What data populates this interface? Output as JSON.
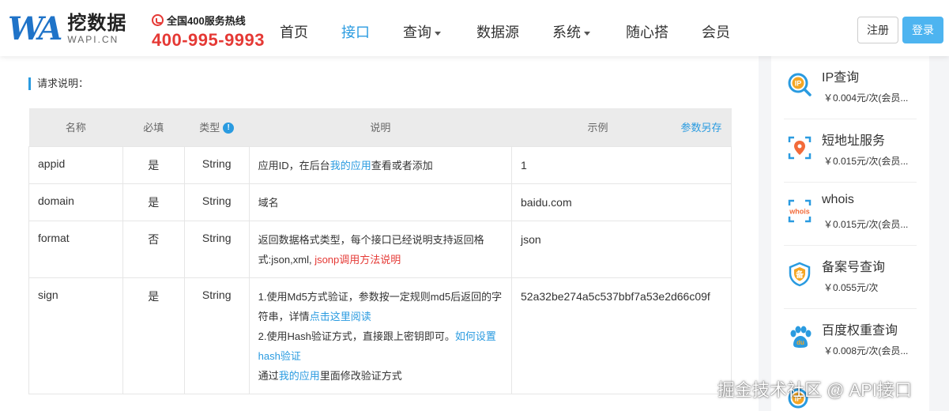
{
  "header": {
    "logo_mark": "WA",
    "logo_cn": "挖数据",
    "logo_en": "WAPI.CN",
    "hotline_label": "全国400服务热线",
    "hotline_number": "400-995-9993",
    "nav": [
      {
        "label": "首页"
      },
      {
        "label": "接口"
      },
      {
        "label": "查询"
      },
      {
        "label": "数据源"
      },
      {
        "label": "系统"
      },
      {
        "label": "随心搭"
      },
      {
        "label": "会员"
      }
    ],
    "register_label": "注册",
    "login_label": "登录"
  },
  "main": {
    "section_title": "请求说明：",
    "columns": {
      "name": "名称",
      "required": "必填",
      "type": "类型",
      "type_info": "!",
      "description": "说明",
      "example": "示例",
      "save_link": "参数另存"
    },
    "rows": [
      {
        "name": "appid",
        "required": "是",
        "type": "String",
        "desc_pre": "应用ID，在后台",
        "desc_link": "我的应用",
        "desc_post": "查看或者添加",
        "example": "1"
      },
      {
        "name": "domain",
        "required": "是",
        "type": "String",
        "desc": "域名",
        "example": "baidu.com"
      },
      {
        "name": "format",
        "required": "否",
        "type": "String",
        "desc_pre": "返回数据格式类型，每个接口已经说明支持返回格式:json,xml, ",
        "desc_link": "jsonp调用方法说明",
        "example": "json"
      },
      {
        "name": "sign",
        "required": "是",
        "type": "String",
        "desc_line1": "1.使用Md5方式验证，参数按一定规则md5后返回的字符串，详情",
        "desc_link1": "点击这里阅读",
        "desc_line2": "2.使用Hash验证方式，直接跟上密钥即可。",
        "desc_link2": "如何设置hash验证",
        "desc_line3_pre": "通过",
        "desc_link3": "我的应用",
        "desc_line3_post": "里面修改验证方式",
        "example": "52a32be274a5c537bbf7a53e2d66c09f"
      }
    ]
  },
  "sidebar": {
    "items": [
      {
        "name": "IP查询",
        "price": "￥0.004元/次(会员...",
        "icon": "ip-icon"
      },
      {
        "name": "短地址服务",
        "price": "￥0.015元/次(会员...",
        "icon": "short-url-icon"
      },
      {
        "name": "whois",
        "price": "￥0.015元/次(会员...",
        "icon": "whois-icon"
      },
      {
        "name": "备案号查询",
        "price": "￥0.055元/次",
        "icon": "beian-icon"
      },
      {
        "name": "百度权重查询",
        "price": "￥0.008元/次(会员...",
        "icon": "baidu-icon"
      }
    ]
  },
  "watermark": "掘金技术社区 @ API接口",
  "colors": {
    "accent": "#2a9be0",
    "required": "#d9534f",
    "hotline": "#e53935",
    "login": "#4db4f0"
  }
}
